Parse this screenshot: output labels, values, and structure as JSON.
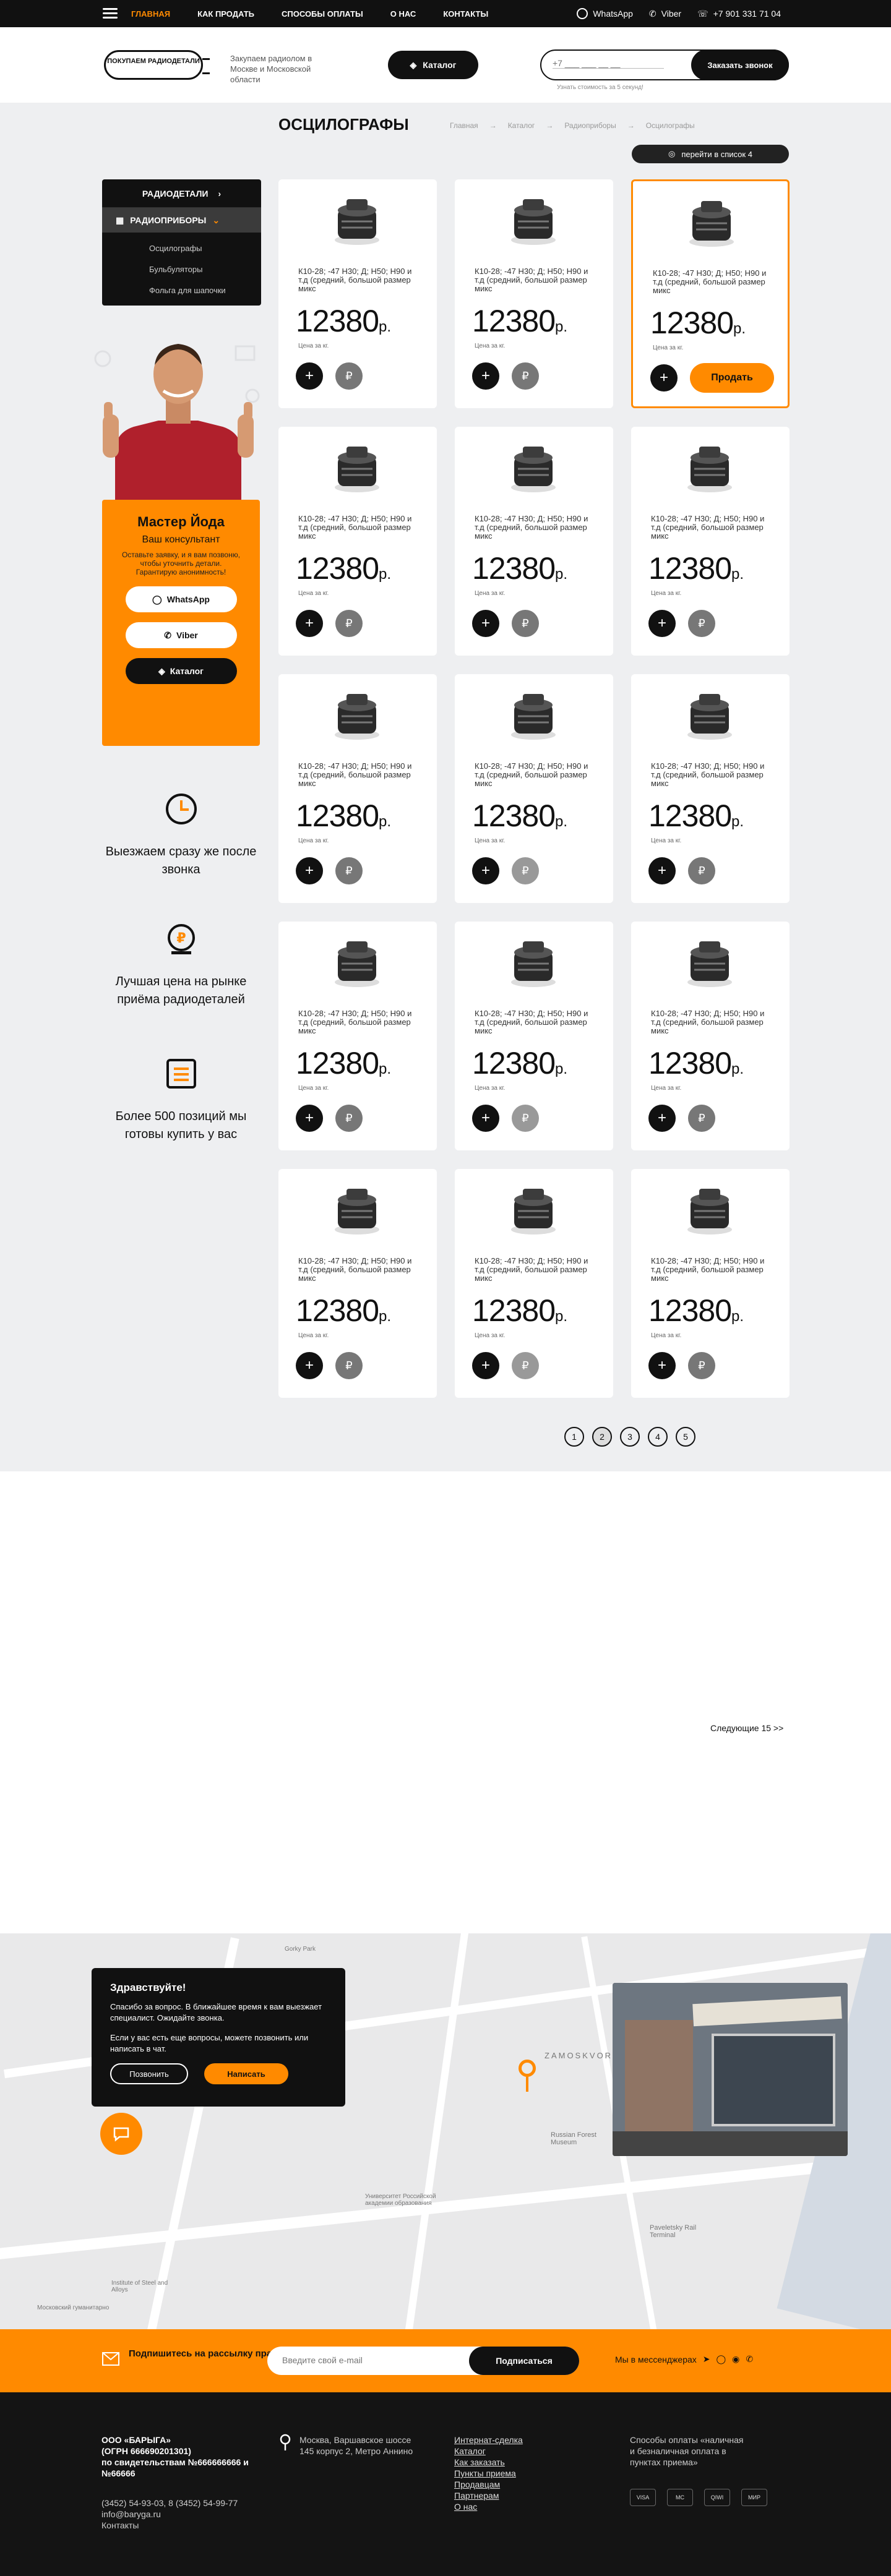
{
  "topbar": {
    "nav": [
      "ГЛАВНАЯ",
      "КАК ПРОДАТЬ",
      "СПОСОБЫ ОПЛАТЫ",
      "О НАС",
      "КОНТАКТЫ"
    ],
    "whatsapp": "WhatsApp",
    "viber": "Viber",
    "phone": "+7 901 331 71 04"
  },
  "header": {
    "logo": "ПОКУПАЕМ РАДИОДЕТАЛИ",
    "slogan": "Закупаем радиолом в Москве и Московской области",
    "catalog": "Каталог",
    "phone_placeholder": "+7 ___ ___ __ __",
    "call_button": "Заказать звонок",
    "hint": "Узнать стоимость за 5 секунд!"
  },
  "page": {
    "title": "ОСЦИЛОГРАФЫ",
    "breadcrumbs": [
      "Главная",
      "Каталог",
      "Радиоприборы",
      "Осцилографы"
    ],
    "list_button": "перейти в список 4"
  },
  "sidemenu": {
    "top": "РАДИОДЕТАЛИ",
    "active": "РАДИОПРИБОРЫ",
    "items": [
      "Осцилографы",
      "Бульбуляторы",
      "Фольга для шапочки"
    ]
  },
  "consultant": {
    "name": "Мастер Йода",
    "role": "Ваш консультант",
    "text": "Оставьте заявку, и я вам позвоню, чтобы уточнить детали. Гарантирую анонимность!",
    "whatsapp": "WhatsApp",
    "viber": "Viber",
    "catalog": "Каталог"
  },
  "features": [
    "Выезжаем сразу же после звонка",
    "Лучшая цена на рынке приёма радиодеталей",
    "Более 500 позиций мы готовы купить у вас"
  ],
  "product": {
    "desc": "К10-28; -47 Н30; Д; Н50; Н90 и т.д (средний, большой размер микс",
    "price": "12380",
    "currency": "р.",
    "price_label": "Цена за кг.",
    "sell": "Продать"
  },
  "pagination": [
    "1",
    "2",
    "3",
    "4",
    "5"
  ],
  "next": "Следующие 15 >>",
  "popup": {
    "title": "Здравствуйте!",
    "text1": "Спасибо за вопрос. В ближайшее время к вам выезжает специалист. Ожидайте звонка.",
    "text2": "Если у вас есть еще вопросы, можете позвонить или написать в чат.",
    "call": "Позвонить",
    "write": "Написать"
  },
  "map": {
    "labels": [
      "ZAMOSKVOR",
      "Russian Forest Museum",
      "Paveletsky Rail Terminal",
      "Университет Российской академии образования",
      "Московский гуманитарно",
      "Institute of Steel and Alloys",
      "Gorky Park"
    ]
  },
  "subscribe": {
    "text": "Подпишитесь на рассылку прайс–листов",
    "placeholder": "Введите свой e-mail",
    "button": "Подписаться",
    "messengers": "Мы в мессенджерах"
  },
  "footer": {
    "company": [
      "ООО «БАРЫГА»",
      "(ОГРН 666690201301)",
      "по свидетельствам №666666666 и №66666"
    ],
    "contacts": [
      "(3452) 54-93-03, 8 (3452) 54-99-77",
      "info@baryga.ru",
      "Контакты"
    ],
    "address": "Москва, Варшавское шоссе 145 корпус 2, Метро Аннино",
    "links": [
      "Интернат-сделка",
      "Каталог",
      "Как заказать",
      "Пункты приема",
      "Продавцам",
      "Партнерам",
      "О нас"
    ],
    "payment": "Способы оплаты «наличная и безналичная оплата в пунктах приема»",
    "pay_icons": [
      "VISA",
      "MC",
      "QIWI",
      "МИР"
    ]
  }
}
